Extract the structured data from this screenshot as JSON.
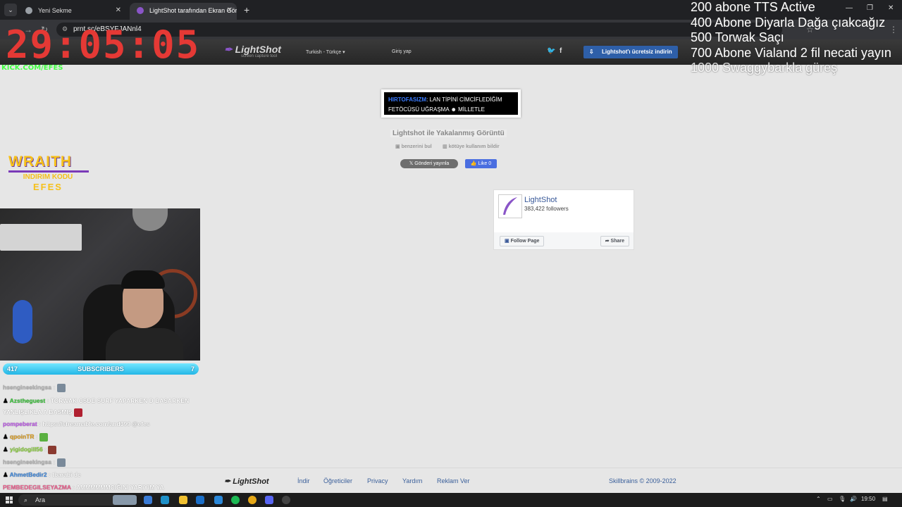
{
  "browser": {
    "tabs": [
      {
        "label": "Yeni Sekme",
        "active": false
      },
      {
        "label": "LightShot tarafından Ekran Görü",
        "active": true
      }
    ],
    "url": "prnt.sc/eBSYFJANnl4"
  },
  "lightshot": {
    "logo": "LightShot",
    "tagline": "screen capture tool",
    "language": "Turkish - Türkçe",
    "login": "Giriş yap",
    "download_label": "Lightshot'ı ücretsiz indirin",
    "screenshot_user": "HIRTOFASIZM",
    "screenshot_text_1": ": LAN TİPİNİ CİMCİFLEDİĞİM",
    "screenshot_text_2": "FETÖCÜSÜ UĞRAŞMA",
    "screenshot_text_3": "MİLLETLE",
    "page_title": "Lightshot ile Yakalanmış Görüntü",
    "find_similar": "benzerini bul",
    "report_abuse": "kötüye kullanım bildir",
    "tweet": "Gönderi yayınla",
    "like": "Like 0",
    "fb_name": "LightShot",
    "fb_followers": "383,422 followers",
    "fb_follow": "Follow Page",
    "fb_share": "Share",
    "footer_logo": "LightShot",
    "footer_links": [
      "İndir",
      "Öğreticiler",
      "Privacy",
      "Yardım",
      "Reklam Ver"
    ],
    "footer_brand": "Skillbrains",
    "footer_copy": " © 2009-2022"
  },
  "stream": {
    "timer": "29:05:05",
    "kick": "KICK.COM/EFES",
    "goals": [
      "200 abone TTS Active",
      "400 Abone Diyarla Dağa çıakcağız",
      "500 Torwak Saçı",
      "700 Abone Vialand 2 fil necati yayın",
      "1000 Swaggybarkla güreş"
    ],
    "badge_1": "WRAITH",
    "badge_2": "INDIRIM KODU",
    "badge_3": "EFES",
    "subs_count": "417",
    "subs_label": "SUBSCRIBERS",
    "subs_target": "7",
    "chat": [
      {
        "user": "hsengineekingsa",
        "msg": " : ",
        "color": "#b9b9b9"
      },
      {
        "user": "Azstheguest",
        "msg": " : TORWAK CSDE SURF YAPARKEN D BASARKEN YANLIŞLIKLA A BASMIŞ",
        "color": "#37c837"
      },
      {
        "user": "pompeberat",
        "msg": " : https://streamable.com/and399 @efes",
        "color": "#c45cf0"
      },
      {
        "user": "qpoinTR",
        "msg": " : ",
        "color": "#e0a020"
      },
      {
        "user": "yigidogill56",
        "msg": " : ",
        "color": "#8cd43a"
      },
      {
        "user": "hsengineekingsa",
        "msg": " : ",
        "color": "#b9b9b9"
      },
      {
        "user": "AhmetBedir2",
        "msg": " : tbarabi dc",
        "color": "#3f8ae0"
      },
      {
        "user": "PEMBEDEGILSEYAZMA",
        "msg": " : AMMMMMMCIĞINI YARIYIM YA",
        "color": "#f06090"
      }
    ]
  },
  "taskbar": {
    "search": "Ara",
    "time": "19:50"
  },
  "colors": {
    "timer": "#e53935",
    "kick": "#44ff44",
    "download_button": "#2e5fa8",
    "link": "#3a5f9a"
  }
}
